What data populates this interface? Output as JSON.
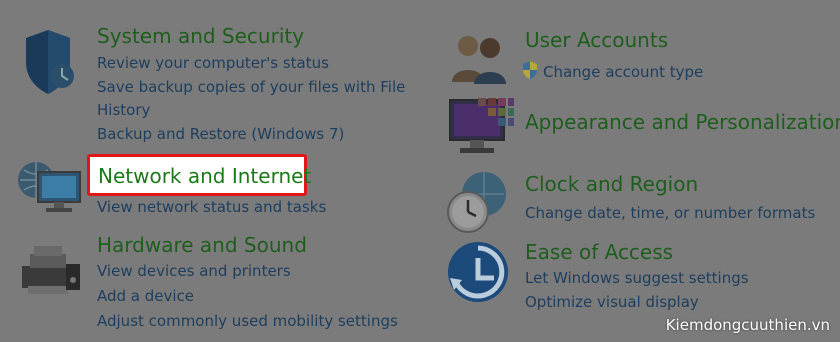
{
  "categories": {
    "system": {
      "title": "System and Security",
      "links": [
        "Review your computer's status",
        "Save backup copies of your files with File",
        "History",
        "Backup and Restore (Windows 7)"
      ]
    },
    "network": {
      "title": "Network and Internet",
      "links": [
        "View network status and tasks"
      ]
    },
    "hardware": {
      "title": "Hardware and Sound",
      "links": [
        "View devices and printers",
        "Add a device",
        "Adjust commonly used mobility settings"
      ]
    },
    "users": {
      "title": "User Accounts",
      "links": [
        "Change account type"
      ]
    },
    "appearance": {
      "title": "Appearance and Personalization"
    },
    "clock": {
      "title": "Clock and Region",
      "links": [
        "Change date, time, or number formats"
      ]
    },
    "ease": {
      "title": "Ease of Access",
      "links": [
        "Let Windows suggest settings",
        "Optimize visual display"
      ]
    }
  },
  "watermark": "Kiemdongcuuthien.vn",
  "colors": {
    "overlay": "#7b7b7b",
    "title_green": "#1e5e1c",
    "link_blue": "#1d3e5e",
    "highlight_border": "#e0161b"
  },
  "icons": {
    "system": "shield-icon",
    "network": "network-globe-icon",
    "hardware": "printer-icon",
    "users": "users-icon",
    "appearance": "monitor-palette-icon",
    "clock": "clock-globe-icon",
    "ease": "ease-of-access-icon"
  }
}
